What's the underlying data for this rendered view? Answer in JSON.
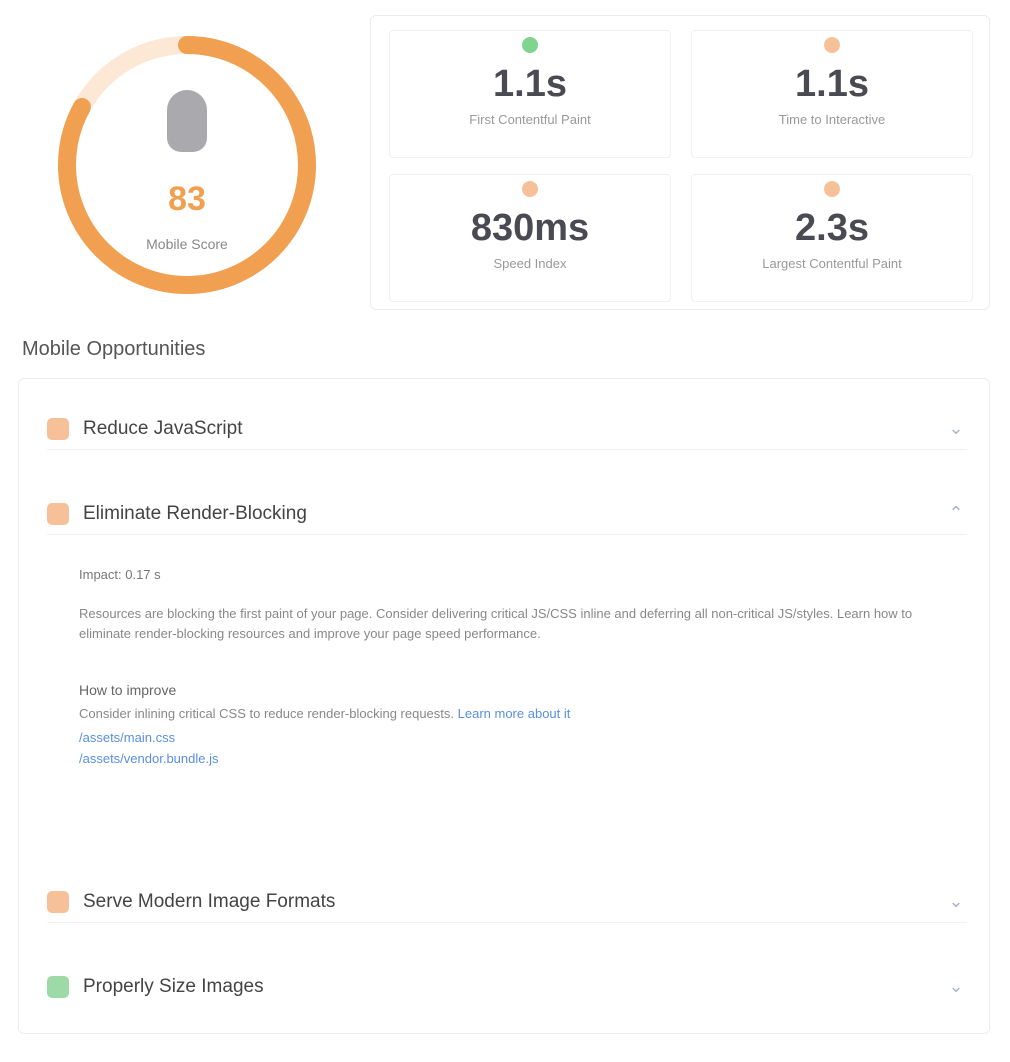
{
  "gauge": {
    "score": "83",
    "label": "Mobile Score",
    "color": "#f0a050",
    "progress": 0.83
  },
  "stats": [
    {
      "value": "1.1s",
      "label": "First Contentful Paint",
      "color": "#7fd48f"
    },
    {
      "value": "1.1s",
      "label": "Time to Interactive",
      "color": "#f6c199"
    },
    {
      "value": "830ms",
      "label": "Speed Index",
      "color": "#f6c199"
    },
    {
      "value": "2.3s",
      "label": "Largest Contentful Paint",
      "color": "#f6c199"
    }
  ],
  "issues_section": {
    "title": "Mobile Opportunities",
    "items": [
      {
        "title": "Reduce JavaScript",
        "badge": "#f6c199"
      },
      {
        "title": "Eliminate Render-Blocking",
        "badge": "#f6c199"
      },
      {
        "title": "Serve Modern Image Formats",
        "badge": "#f6c199"
      },
      {
        "title": "Properly Size Images",
        "badge": "#9ed9a8"
      }
    ],
    "detail": {
      "meta": "Impact: 0.17 s",
      "description": "Resources are blocking the first paint of your page. Consider delivering critical JS/CSS inline and deferring all non-critical JS/styles. Learn how to eliminate render-blocking resources and improve your page speed performance.",
      "how_title": "How to improve",
      "how_text": "Consider inlining critical CSS to reduce render-blocking requests.",
      "how_link": "Learn more about it",
      "links": [
        "/assets/main.css",
        "/assets/vendor.bundle.js"
      ]
    }
  }
}
